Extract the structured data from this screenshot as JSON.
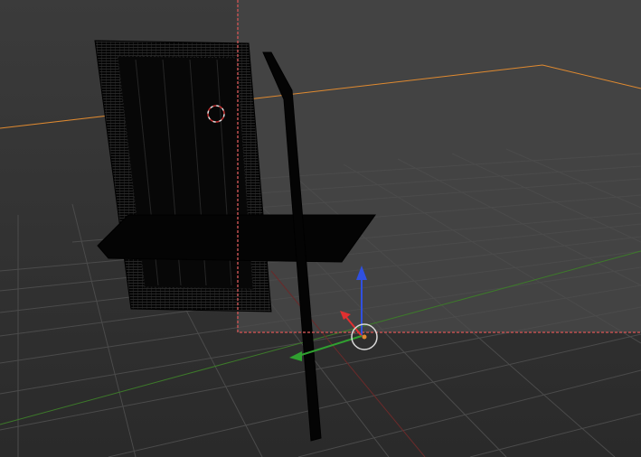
{
  "viewport": {
    "colors": {
      "background_top": "#3d3d3d",
      "background_bottom": "#262626",
      "camera_bg": "#404040",
      "grid": "#4a4a4a",
      "x_axis": "#8a2a2a",
      "y_axis": "#3d7a2a",
      "camera_border": "#c05050",
      "selection_outline": "#e08a30",
      "gizmo_x": "#e03030",
      "gizmo_y": "#30a030",
      "gizmo_z": "#3050e0",
      "object": "#050505",
      "wire": "#1a1a1a",
      "cursor_ring": "#d8d8d8"
    },
    "icons": {
      "cursor": "3d-cursor-icon",
      "gizmo": "transform-gizmo-icon"
    }
  }
}
